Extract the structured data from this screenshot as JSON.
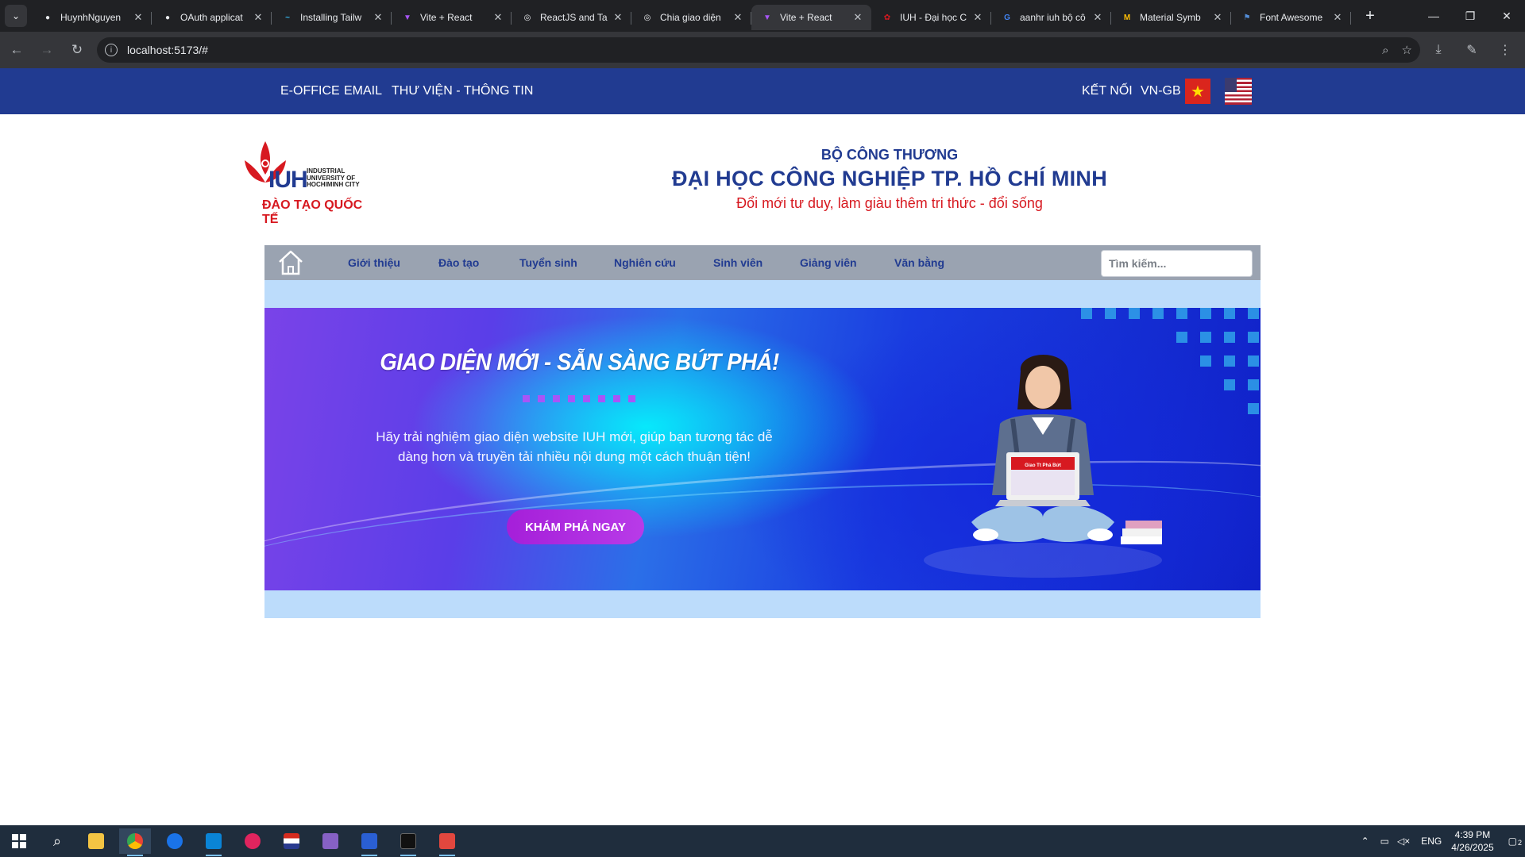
{
  "browser": {
    "tabs": [
      {
        "title": "HuynhNguyen",
        "color": "#e8eaed",
        "glyph": "●"
      },
      {
        "title": "OAuth applicat",
        "color": "#e8eaed",
        "glyph": "●"
      },
      {
        "title": "Installing Tailw",
        "color": "#38bdf8",
        "glyph": "~"
      },
      {
        "title": "Vite + React",
        "color": "#a855f7",
        "glyph": "▼"
      },
      {
        "title": "ReactJS and Ta",
        "color": "#e8eaed",
        "glyph": "◎"
      },
      {
        "title": "Chia giao diện",
        "color": "#e8eaed",
        "glyph": "◎"
      },
      {
        "title": "Vite + React",
        "color": "#a855f7",
        "glyph": "▼"
      },
      {
        "title": "IUH - Đại học C",
        "color": "#d71920",
        "glyph": "✿"
      },
      {
        "title": "aanhr iuh bộ cô",
        "color": "#4285f4",
        "glyph": "G"
      },
      {
        "title": "Material Symb",
        "color": "#fbbc05",
        "glyph": "M"
      },
      {
        "title": "Font Awesome",
        "color": "#538dd7",
        "glyph": "⚑"
      }
    ],
    "active_tab_index": 6,
    "url": "localhost:5173/#"
  },
  "topbar": {
    "links": [
      "E-OFFICE",
      "EMAIL",
      "THƯ VIỆN - THÔNG TIN"
    ],
    "connect": "KẾT NỐI",
    "lang": "VN-GB"
  },
  "logo": {
    "abbr": "IUH",
    "sub1": "INDUSTRIAL",
    "sub2": "UNIVERSITY OF",
    "sub3": "HOCHIMINH CITY",
    "tagline": "ĐÀO TẠO QUỐC TẾ"
  },
  "header": {
    "ministry": "BỘ CÔNG THƯƠNG",
    "title": "ĐẠI HỌC CÔNG NGHIỆP TP. HỒ CHÍ MINH",
    "slogan": "Đổi mới tư duy, làm giàu thêm tri thức - đổi sống"
  },
  "nav": {
    "items": [
      "Giới thiệu",
      "Đào tạo",
      "Tuyển sinh",
      "Nghiên cứu",
      "Sinh viên",
      "Giảng viên",
      "Văn bằng"
    ],
    "search_placeholder": "Tìm kiếm..."
  },
  "hero": {
    "title": "GIAO DIỆN MỚI - SẴN SÀNG BỨT PHÁ!",
    "desc_line1": "Hãy trải nghiệm giao diện website IUH mới, giúp bạn tương tác dễ",
    "desc_line2": "dàng hơn và truyền tải nhiều nội dung một cách thuận tiện!",
    "button": "KHÁM PHÁ NGAY",
    "laptop_text": "Giao Tt Phá Bứt"
  },
  "taskbar": {
    "lang": "ENG",
    "time": "4:39 PM",
    "date": "4/26/2025",
    "notifications": "2"
  },
  "colors": {
    "primary": "#213b91",
    "accent_red": "#d71920",
    "nav_bg": "#9aa3b1",
    "band": "#bcdcfb"
  }
}
